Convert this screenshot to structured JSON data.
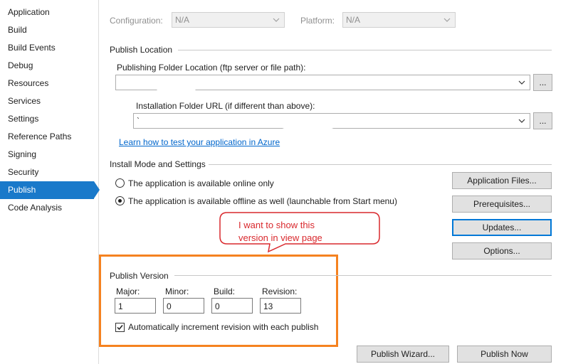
{
  "nav": {
    "items": [
      {
        "label": "Application"
      },
      {
        "label": "Build"
      },
      {
        "label": "Build Events"
      },
      {
        "label": "Debug"
      },
      {
        "label": "Resources"
      },
      {
        "label": "Services"
      },
      {
        "label": "Settings"
      },
      {
        "label": "Reference Paths"
      },
      {
        "label": "Signing"
      },
      {
        "label": "Security"
      },
      {
        "label": "Publish"
      },
      {
        "label": "Code Analysis"
      }
    ],
    "active_index": 10,
    "accent": "#1979ca"
  },
  "top": {
    "configuration_label": "Configuration:",
    "configuration_value": "N/A",
    "platform_label": "Platform:",
    "platform_value": "N/A"
  },
  "publish_location": {
    "group_title": "Publish Location",
    "folder_label": "Publishing Folder Location (ftp server or file path):",
    "folder_value": "",
    "browse_label": "...",
    "install_url_label": "Installation Folder URL (if different than above):",
    "install_url_value": "`",
    "install_browse_label": "...",
    "azure_link": "Learn how to test your application in Azure"
  },
  "install_mode": {
    "group_title": "Install Mode and Settings",
    "option_online": "The application is available online only",
    "option_offline": "The application is available offline as well (launchable from Start menu)",
    "selected": "offline",
    "buttons": {
      "application_files": "Application Files...",
      "prerequisites": "Prerequisites...",
      "updates": "Updates...",
      "options": "Options..."
    }
  },
  "annotation": {
    "text_line1": "I want to show this",
    "text_line2": "version in view page",
    "bubble_color": "#d9282d",
    "box_color": "#f58220"
  },
  "publish_version": {
    "group_title": "Publish Version",
    "major_label": "Major:",
    "major_value": "1",
    "minor_label": "Minor:",
    "minor_value": "0",
    "build_label": "Build:",
    "build_value": "0",
    "revision_label": "Revision:",
    "revision_value": "13",
    "auto_increment_label": "Automatically increment revision with each publish",
    "auto_increment_checked": true
  },
  "footer": {
    "wizard_label": "Publish Wizard...",
    "publish_now_label": "Publish Now"
  }
}
